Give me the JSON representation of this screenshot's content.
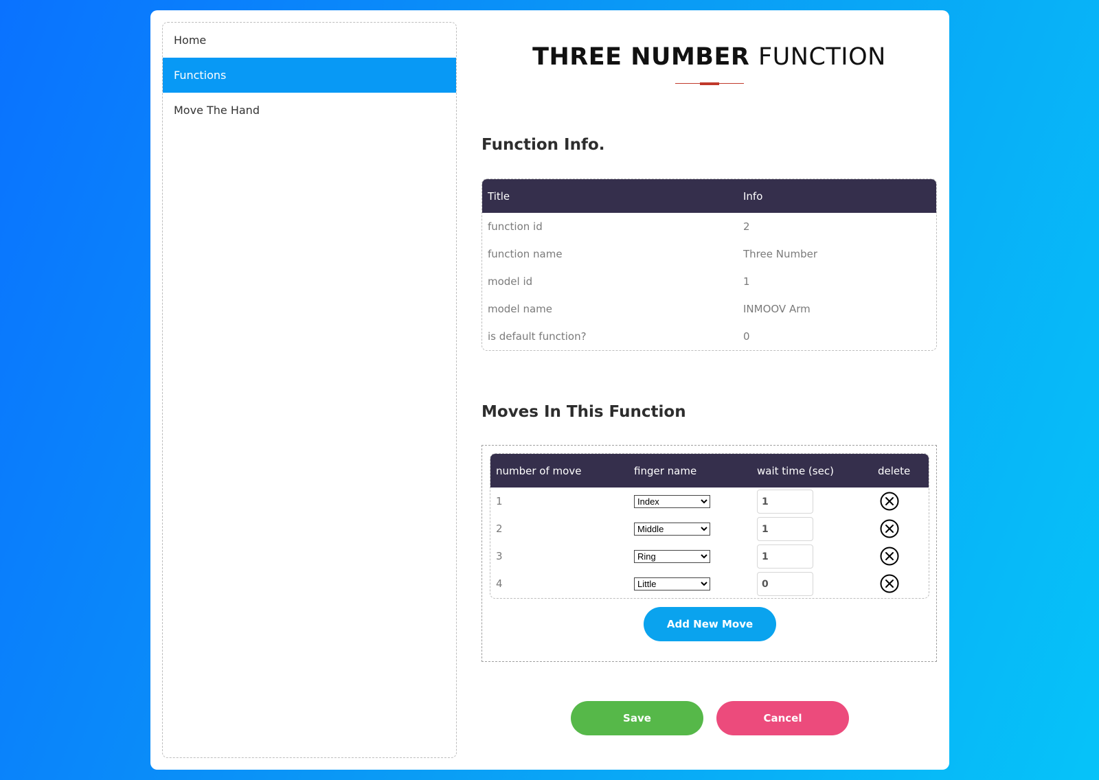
{
  "sidebar": {
    "items": [
      {
        "label": "Home"
      },
      {
        "label": "Functions"
      },
      {
        "label": "Move The Hand"
      }
    ]
  },
  "header": {
    "title_bold": "THREE NUMBER",
    "title_light": "FUNCTION"
  },
  "info_section": {
    "heading": "Function Info.",
    "columns": [
      "Title",
      "Info"
    ],
    "rows": [
      [
        "function id",
        "2"
      ],
      [
        "function name",
        "Three Number"
      ],
      [
        "model id",
        "1"
      ],
      [
        "model name",
        "INMOOV Arm"
      ],
      [
        "is default function?",
        "0"
      ]
    ]
  },
  "moves_section": {
    "heading": "Moves In This Function",
    "columns": [
      "number of move",
      "finger name",
      "wait time (sec)",
      "delete"
    ],
    "rows": [
      {
        "number": "1",
        "finger": "Index",
        "wait": "1"
      },
      {
        "number": "2",
        "finger": "Middle",
        "wait": "1"
      },
      {
        "number": "3",
        "finger": "Ring",
        "wait": "1"
      },
      {
        "number": "4",
        "finger": "Little",
        "wait": "0"
      }
    ],
    "add_label": "Add New Move"
  },
  "actions": {
    "save_label": "Save",
    "cancel_label": "Cancel"
  },
  "colors": {
    "accent": "#0899f5",
    "table_header": "#352f4c",
    "save": "#56b849",
    "cancel": "#ec4b7c",
    "title_underline": "#c0392b"
  },
  "icons": {
    "delete": "close-circle-icon"
  }
}
